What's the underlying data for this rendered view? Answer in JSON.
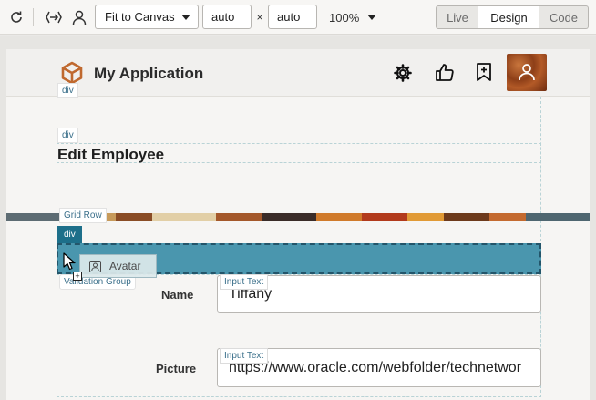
{
  "toolbar": {
    "fit_select": "Fit to Canvas",
    "width_value": "auto",
    "times": "×",
    "height_value": "auto",
    "zoom": "100%",
    "modes": [
      "Live",
      "Design",
      "Code"
    ],
    "active_mode": "Design"
  },
  "app": {
    "title": "My Application"
  },
  "canvas": {
    "div_tag_1": "div",
    "div_tag_2": "div",
    "page_heading": "Edit Employee",
    "grid_row_tag": "Grid Row",
    "div_tag_selected": "div",
    "validation_group_tag": "Validation Group",
    "drag_item": "Avatar",
    "fields": [
      {
        "label": "Name",
        "tag": "Input Text",
        "value": "Tiffany"
      },
      {
        "label": "Picture",
        "tag": "Input Text",
        "value": "https://www.oracle.com/webfolder/technetwor"
      }
    ]
  },
  "colors": {
    "accent": "#1d6f8a",
    "selection": "#4a96ae",
    "brand_orange": "#c0692f"
  }
}
